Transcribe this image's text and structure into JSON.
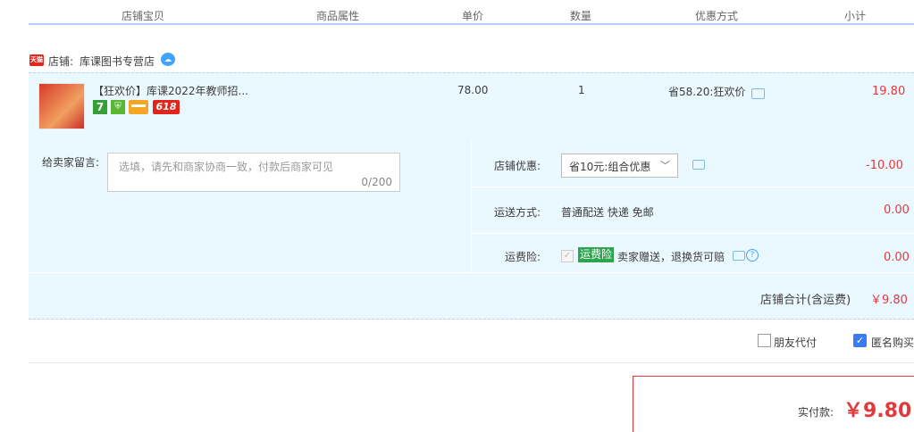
{
  "header": {
    "col_item": "店铺宝贝",
    "col_attr": "商品属性",
    "col_price": "单价",
    "col_qty": "数量",
    "col_promo": "优惠方式",
    "col_subtotal": "小计"
  },
  "shop": {
    "badge": "天猫",
    "label": "店铺:",
    "name": "库课图书专营店"
  },
  "item": {
    "title": "【狂欢价】库课2022年教师招...",
    "badge_7": "7",
    "badge_618": "618",
    "unit_price": "78.00",
    "quantity": "1",
    "promo": "省58.20:狂欢价",
    "subtotal": "19.80"
  },
  "message": {
    "label": "给卖家留言:",
    "placeholder": "选填，请先和商家协商一致，付款后商家可见",
    "count": "0/200"
  },
  "shop_discount": {
    "label": "店铺优惠:",
    "selected": "省10元:组合优惠",
    "amount": "-10.00"
  },
  "shipping": {
    "label": "运送方式:",
    "value": "普通配送 快递 免邮",
    "amount": "0.00"
  },
  "insurance": {
    "label": "运费险:",
    "tag": "运费险",
    "desc": "卖家赠送，退换货可赔",
    "amount": "0.00"
  },
  "shop_total": {
    "label": "店铺合计(含运费)",
    "amount": "￥9.80"
  },
  "options": {
    "friend_pay": "朋友代付",
    "anonymous": "匿名购买"
  },
  "pay": {
    "label": "实付款:",
    "amount": "￥9.80"
  },
  "colors": {
    "accent_red": "#e4393c",
    "panel_bg": "#eaf8ff",
    "header_line": "#b2d1ff"
  }
}
